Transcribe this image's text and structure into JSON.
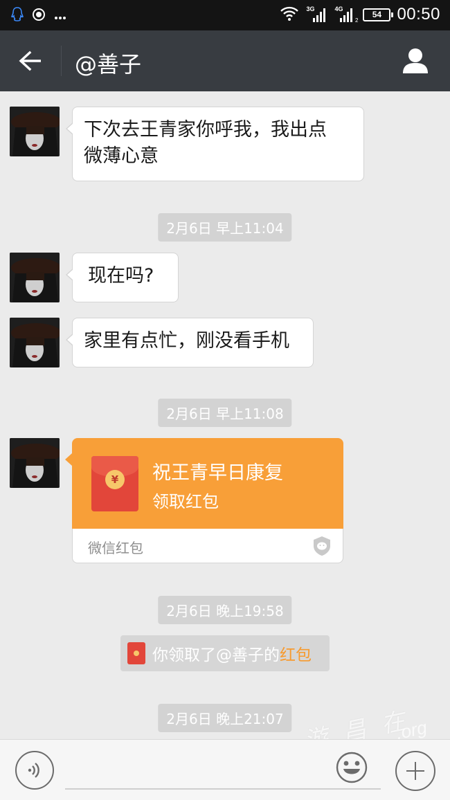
{
  "status_bar": {
    "time": "00:50",
    "battery": "54",
    "network_1": "3G",
    "network_2": "4G",
    "network_2_sub": "2"
  },
  "header": {
    "title": "@善子"
  },
  "messages": [
    {
      "text_line1": "下次去王青家你呼我，我出点",
      "text_line2": "微薄心意"
    },
    {
      "text": "现在吗?"
    },
    {
      "text": "家里有点忙，刚没看手机"
    }
  ],
  "timestamps": [
    "2月6日 早上11:04",
    "2月6日 早上11:08",
    "2月6日 晚上19:58",
    "2月6日 晚上21:07"
  ],
  "red_packet": {
    "title": "祝王青早日康复",
    "action": "领取红包",
    "footer": "微信红包",
    "coin_symbol": "¥",
    "color": "#f89f38"
  },
  "notice": {
    "prefix": "你领取了@善子的",
    "link": "红包"
  },
  "watermark": {
    "text": "游 昌 在 线",
    "suffix": ".org"
  },
  "input_bar": {
    "placeholder": ""
  },
  "colors": {
    "titlebar": "#383c41",
    "background": "#ebebeb",
    "accent_orange": "#f89f38",
    "red": "#e2463a"
  }
}
